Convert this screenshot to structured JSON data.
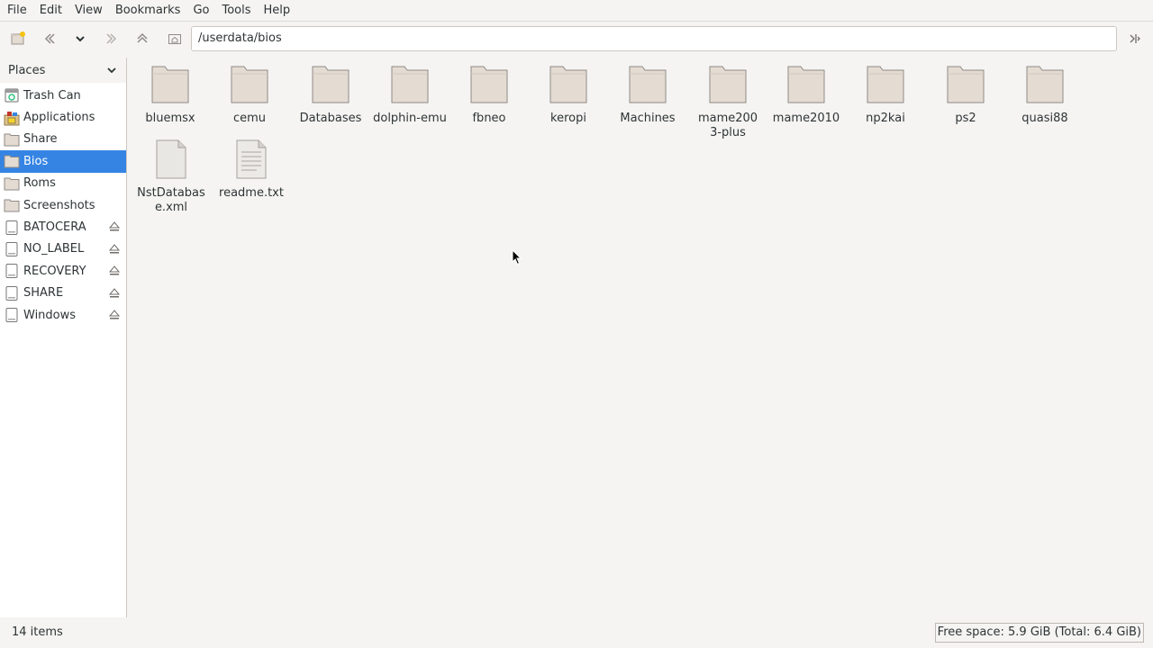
{
  "menubar": {
    "items": [
      "File",
      "Edit",
      "View",
      "Bookmarks",
      "Go",
      "Tools",
      "Help"
    ]
  },
  "toolbar": {
    "location_path": "/userdata/bios"
  },
  "sidebar": {
    "header": "Places",
    "items": [
      {
        "label": "Trash Can",
        "icon": "trash-icon"
      },
      {
        "label": "Applications",
        "icon": "applications-icon"
      },
      {
        "label": "Share",
        "icon": "folder-icon"
      },
      {
        "label": "Bios",
        "icon": "folder-icon",
        "selected": true
      },
      {
        "label": "Roms",
        "icon": "folder-icon"
      },
      {
        "label": "Screenshots",
        "icon": "folder-icon"
      },
      {
        "label": "BATOCERA",
        "icon": "drive-icon",
        "eject": true
      },
      {
        "label": "NO_LABEL",
        "icon": "drive-icon",
        "eject": true
      },
      {
        "label": "RECOVERY",
        "icon": "drive-icon",
        "eject": true
      },
      {
        "label": "SHARE",
        "icon": "drive-icon",
        "eject": true
      },
      {
        "label": "Windows",
        "icon": "drive-icon",
        "eject": true
      }
    ]
  },
  "files": [
    {
      "label": "bluemsx",
      "type": "folder"
    },
    {
      "label": "cemu",
      "type": "folder"
    },
    {
      "label": "Databases",
      "type": "folder"
    },
    {
      "label": "dolphin-emu",
      "type": "folder"
    },
    {
      "label": "fbneo",
      "type": "folder"
    },
    {
      "label": "keropi",
      "type": "folder"
    },
    {
      "label": "Machines",
      "type": "folder"
    },
    {
      "label": "mame2003-plus",
      "type": "folder"
    },
    {
      "label": "mame2010",
      "type": "folder"
    },
    {
      "label": "np2kai",
      "type": "folder"
    },
    {
      "label": "ps2",
      "type": "folder"
    },
    {
      "label": "quasi88",
      "type": "folder"
    },
    {
      "label": "NstDatabase.xml",
      "type": "file"
    },
    {
      "label": "readme.txt",
      "type": "file"
    }
  ],
  "statusbar": {
    "count": "14 items",
    "free_space": "Free space: 5.9 GiB (Total: 6.4 GiB)"
  },
  "colors": {
    "selection": "#3584e4",
    "folder": "#e4dcd3",
    "background": "#f5f4f2"
  }
}
